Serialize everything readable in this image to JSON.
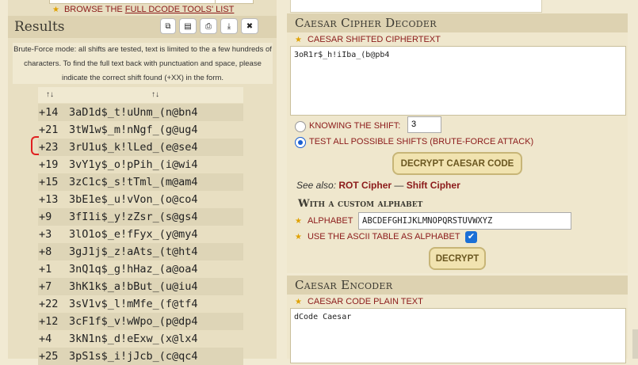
{
  "browse_link": {
    "prefix": "BROWSE THE ",
    "link": "FULL DCODE TOOLS' LIST"
  },
  "results": {
    "title": "Results",
    "tools": [
      "copy-icon",
      "save-icon",
      "print-icon",
      "download-icon",
      "close-icon"
    ],
    "note": "Brute-Force mode: all shifts are tested, text is limited to the a few hundreds of characters. To find the full text back with punctuation and space, please indicate the correct shift found (+XX) in the form.",
    "sort_label_shift": "↑↓",
    "sort_label_text": "↑↓",
    "rows": [
      {
        "shift": "+14",
        "text": "3aD1d$_t!uUnm_(n@bn4"
      },
      {
        "shift": "+21",
        "text": "3tW1w$_m!nNgf_(g@ug4"
      },
      {
        "shift": "+23",
        "text": "3rU1u$_k!lLed_(e@se4"
      },
      {
        "shift": "+19",
        "text": "3vY1y$_o!pPih_(i@wi4"
      },
      {
        "shift": "+15",
        "text": "3zC1c$_s!tTml_(m@am4"
      },
      {
        "shift": "+13",
        "text": "3bE1e$_u!vVon_(o@co4"
      },
      {
        "shift": "+9",
        "text": "3fI1i$_y!zZsr_(s@gs4"
      },
      {
        "shift": "+3",
        "text": "3lO1o$_e!fFyx_(y@my4"
      },
      {
        "shift": "+8",
        "text": "3gJ1j$_z!aAts_(t@ht4"
      },
      {
        "shift": "+1",
        "text": "3nQ1q$_g!hHaz_(a@oa4"
      },
      {
        "shift": "+7",
        "text": "3hK1k$_a!bBut_(u@iu4"
      },
      {
        "shift": "+22",
        "text": "3sV1v$_l!mMfe_(f@tf4"
      },
      {
        "shift": "+12",
        "text": "3cF1f$_v!wWpo_(p@dp4"
      },
      {
        "shift": "+4",
        "text": "3kN1n$_d!eExw_(x@lx4"
      },
      {
        "shift": "+25",
        "text": "3pS1s$_i!jJcb_(c@qc4"
      }
    ]
  },
  "decoder": {
    "title": "Caesar Cipher Decoder",
    "ciphertext_label": "CAESAR SHIFTED CIPHERTEXT",
    "ciphertext": "3oR1r$_h!iIba_(b@pb4",
    "knowing_shift_label": "KNOWING THE SHIFT:",
    "shift_value": "3",
    "bruteforce_label": "TEST ALL POSSIBLE SHIFTS (BRUTE-FORCE ATTACK)",
    "decrypt_button": "DECRYPT CAESAR CODE",
    "see_also_label": "See also:",
    "see_also_link1": "ROT Cipher",
    "see_also_sep": " — ",
    "see_also_link2": "Shift Cipher",
    "custom_alphabet_title": "With a custom alphabet",
    "alphabet_label": "ALPHABET",
    "alphabet_value": "ABCDEFGHIJKLMNOPQRSTUVWXYZ",
    "ascii_label": "USE THE ASCII TABLE AS ALPHABET",
    "decrypt2_button": "DECRYPT"
  },
  "encoder": {
    "title": "Caesar Encoder",
    "plaintext_label": "CAESAR CODE PLAIN TEXT",
    "plaintext": "dCode Caesar"
  }
}
